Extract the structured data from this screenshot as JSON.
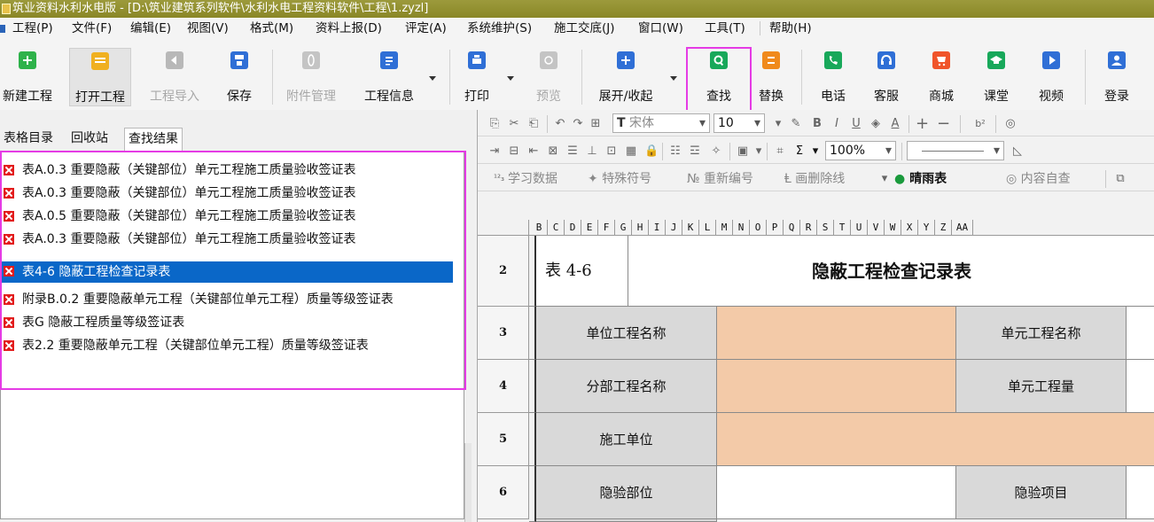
{
  "window": {
    "title": "筑业资料水利水电版 - [D:\\筑业建筑系列软件\\水利水电工程资料软件\\工程\\1.zyzl]"
  },
  "menu": {
    "items": [
      "工程(P)",
      "文件(F)",
      "编辑(E)",
      "视图(V)",
      "格式(M)",
      "资料上报(D)",
      "评定(A)",
      "系统维护(S)",
      "施工交底(J)",
      "窗口(W)",
      "工具(T)",
      "帮助(H)"
    ]
  },
  "toolbar": {
    "buttons": [
      {
        "label": "新建工程",
        "icon": "new-project-icon",
        "color": "#2eb24a",
        "state": "enabled"
      },
      {
        "label": "打开工程",
        "icon": "open-folder-icon",
        "color": "#f0b020",
        "state": "pressed"
      },
      {
        "label": "工程导入",
        "icon": "import-icon",
        "color": "#b8b8b8",
        "state": "disabled"
      },
      {
        "label": "保存",
        "icon": "save-icon",
        "color": "#2f6fd6",
        "state": "enabled"
      },
      {
        "label": "附件管理",
        "icon": "attachment-icon",
        "color": "#c4c4c4",
        "state": "disabled"
      },
      {
        "label": "工程信息",
        "icon": "document-icon",
        "color": "#2f6fd6",
        "state": "enabled"
      },
      {
        "label": "打印",
        "icon": "printer-icon",
        "color": "#2f6fd6",
        "state": "enabled"
      },
      {
        "label": "预览",
        "icon": "preview-icon",
        "color": "#c4c4c4",
        "state": "disabled"
      },
      {
        "label": "展开/收起",
        "icon": "expand-icon",
        "color": "#2f6fd6",
        "state": "enabled"
      },
      {
        "label": "查找",
        "icon": "search-icon",
        "color": "#18a85a",
        "state": "highlighted"
      },
      {
        "label": "替换",
        "icon": "replace-icon",
        "color": "#f08a1c",
        "state": "enabled"
      },
      {
        "label": "电话",
        "icon": "phone-icon",
        "color": "#18a85a",
        "state": "enabled"
      },
      {
        "label": "客服",
        "icon": "headset-icon",
        "color": "#2f6fd6",
        "state": "enabled"
      },
      {
        "label": "商城",
        "icon": "cart-icon",
        "color": "#f0542a",
        "state": "enabled"
      },
      {
        "label": "课堂",
        "icon": "graduation-icon",
        "color": "#18a85a",
        "state": "enabled"
      },
      {
        "label": "视频",
        "icon": "play-icon",
        "color": "#2f6fd6",
        "state": "enabled"
      },
      {
        "label": "登录",
        "icon": "user-icon",
        "color": "#2f6fd6",
        "state": "enabled"
      }
    ]
  },
  "left_pane": {
    "tabs": [
      "表格目录",
      "回收站",
      "查找结果"
    ],
    "active_tab": "查找结果",
    "results": [
      {
        "text": "表A.0.3 重要隐蔽（关键部位）单元工程施工质量验收签证表",
        "selected": false
      },
      {
        "text": "表A.0.3 重要隐蔽（关键部位）单元工程施工质量验收签证表",
        "selected": false
      },
      {
        "text": "表A.0.5 重要隐蔽（关键部位）单元工程施工质量验收签证表",
        "selected": false
      },
      {
        "text": "表A.0.3 重要隐蔽（关键部位）单元工程施工质量验收签证表",
        "selected": false
      },
      {
        "text": "表4-6 隐蔽工程检查记录表",
        "selected": true
      },
      {
        "text": "附录B.0.2 重要隐蔽单元工程（关键部位单元工程）质量等级签证表",
        "selected": false
      },
      {
        "text": "表G 隐蔽工程质量等级签证表",
        "selected": false
      },
      {
        "text": "表2.2 重要隐蔽单元工程（关键部位单元工程）质量等级签证表",
        "selected": false
      }
    ]
  },
  "format_toolbar": {
    "font_name": "宋体",
    "font_size": "10",
    "zoom": "100%",
    "extra_items": [
      "学习数据",
      "特殊符号",
      "重新编号",
      "画删除线",
      "晴雨表",
      "内容自查"
    ]
  },
  "sheet": {
    "columns": [
      "B",
      "C",
      "D",
      "E",
      "F",
      "G",
      "H",
      "I",
      "J",
      "K",
      "L",
      "M",
      "N",
      "O",
      "P",
      "Q",
      "R",
      "S",
      "T",
      "U",
      "V",
      "W",
      "X",
      "Y",
      "Z",
      "AA"
    ],
    "rows": [
      {
        "number": "2",
        "table_no": "表 4-6",
        "title": "隐蔽工程检查记录表"
      },
      {
        "number": "3",
        "label_a": "单位工程名称",
        "label_b": "单元工程名称"
      },
      {
        "number": "4",
        "label_a": "分部工程名称",
        "label_b": "单元工程量"
      },
      {
        "number": "5",
        "label_a": "施工单位"
      },
      {
        "number": "6",
        "label_a": "隐验部位",
        "label_b": "隐验项目"
      }
    ],
    "colors": {
      "input_fill": "#f3caa8",
      "label_fill": "#d9d9d9"
    }
  },
  "accent": {
    "highlight_frame": "#e53be5",
    "selection": "#0a67c8"
  }
}
